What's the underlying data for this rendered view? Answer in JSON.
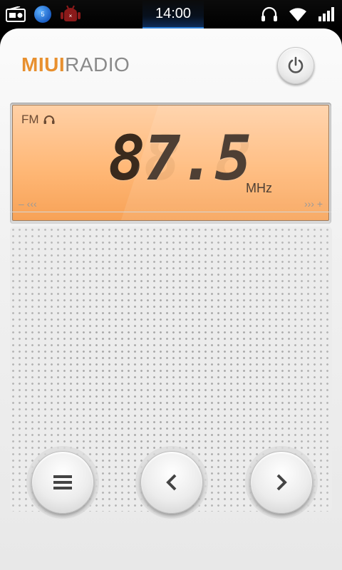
{
  "status_bar": {
    "time": "14:00",
    "notification_badge": "5",
    "icons": [
      "radio-notification-icon",
      "notification-badge-icon",
      "android-debug-icon",
      "headphones-icon",
      "wifi-icon",
      "signal-icon"
    ]
  },
  "app": {
    "brand_part1": "MIUI",
    "brand_part2": "RADIO",
    "accent_color": "#e8902f"
  },
  "display": {
    "band": "FM",
    "frequency": "87.5",
    "ghost_digits": "88.8",
    "unit": "MHz",
    "lcd_color": "#ffb877"
  },
  "tuner": {
    "minus_label": "– ‹‹‹",
    "plus_label": "››› +"
  },
  "controls": {
    "menu_icon": "menu-icon",
    "prev_icon": "chevron-left-icon",
    "next_icon": "chevron-right-icon",
    "power_icon": "power-icon"
  }
}
